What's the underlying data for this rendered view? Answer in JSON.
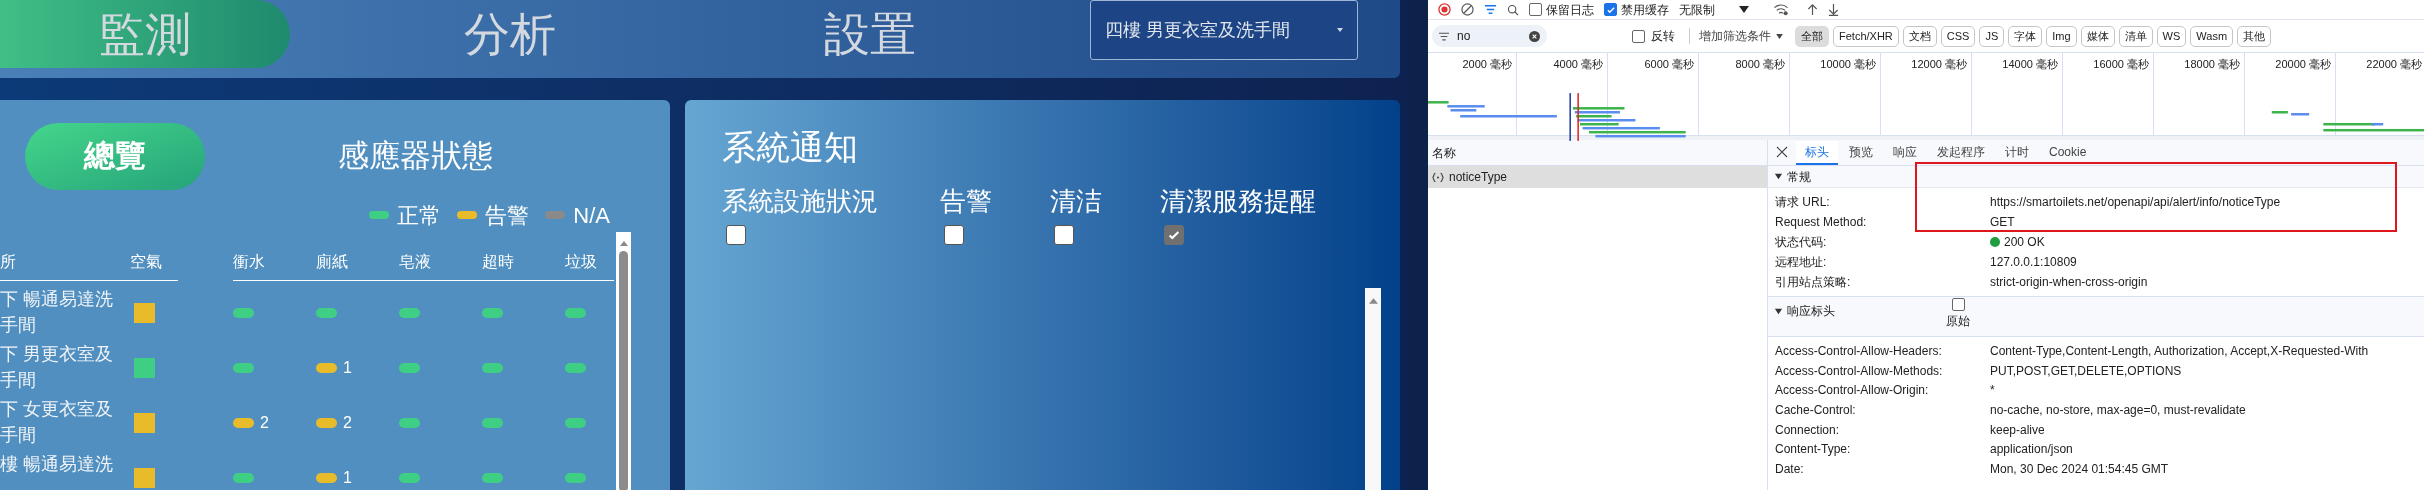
{
  "nav": {
    "tabs": [
      {
        "label": "監測",
        "selected": true
      },
      {
        "label": "分析",
        "selected": false
      },
      {
        "label": "設置",
        "selected": false
      }
    ],
    "location_select": {
      "value": "四樓 男更衣室及洗手間"
    }
  },
  "sensor_panel": {
    "overview_button": "總覽",
    "title": "感應器狀態",
    "legend": [
      {
        "label": "正常",
        "color": "#3ecf85"
      },
      {
        "label": "告警",
        "color": "#e8bb2b"
      },
      {
        "label": "N/A",
        "color": "#8a8a8a"
      }
    ],
    "columns": [
      "所",
      "空氣",
      "衝水",
      "廁紙",
      "皂液",
      "超時",
      "垃圾"
    ],
    "rows": [
      {
        "name": [
          "下 暢通易達洗",
          "手間"
        ],
        "air_alert": true,
        "sensors": [
          {
            "alert": false
          },
          {
            "alert": false
          },
          {
            "alert": false
          },
          {
            "alert": false
          },
          {
            "alert": false
          }
        ]
      },
      {
        "name": [
          "下 男更衣室及",
          "手間"
        ],
        "air_alert": false,
        "sensors": [
          {
            "alert": false
          },
          {
            "alert": true,
            "count": "1"
          },
          {
            "alert": false
          },
          {
            "alert": false
          },
          {
            "alert": false
          }
        ]
      },
      {
        "name": [
          "下 女更衣室及",
          "手間"
        ],
        "air_alert": true,
        "sensors": [
          {
            "alert": true,
            "count": "2"
          },
          {
            "alert": true,
            "count": "2"
          },
          {
            "alert": false
          },
          {
            "alert": false
          },
          {
            "alert": false
          }
        ]
      },
      {
        "name": [
          "樓 暢通易達洗"
        ],
        "air_alert": true,
        "sensors": [
          {
            "alert": false
          },
          {
            "alert": true,
            "count": "1"
          },
          {
            "alert": false
          },
          {
            "alert": false
          },
          {
            "alert": false
          }
        ]
      }
    ]
  },
  "notice_panel": {
    "title": "系統通知",
    "options": [
      {
        "label": "系統設施狀況",
        "checked": false
      },
      {
        "label": "告警",
        "checked": false
      },
      {
        "label": "清洁",
        "checked": false
      },
      {
        "label": "清潔服務提醒",
        "checked": true
      }
    ]
  },
  "devtools": {
    "toolbar": {
      "preserve_log": {
        "label": "保留日志",
        "checked": false
      },
      "disable_cache": {
        "label": "禁用缓存",
        "checked": true
      },
      "throttle": "无限制"
    },
    "filter": {
      "value": "no",
      "invert": {
        "label": "反转",
        "checked": false
      },
      "more_filters": "增加筛选条件",
      "types": [
        {
          "label": "全部",
          "selected": true
        },
        {
          "label": "Fetch/XHR",
          "selected": false
        },
        {
          "label": "文档",
          "selected": false
        },
        {
          "label": "CSS",
          "selected": false
        },
        {
          "label": "JS",
          "selected": false
        },
        {
          "label": "字体",
          "selected": false
        },
        {
          "label": "Img",
          "selected": false
        },
        {
          "label": "媒体",
          "selected": false
        },
        {
          "label": "清单",
          "selected": false
        },
        {
          "label": "WS",
          "selected": false
        },
        {
          "label": "Wasm",
          "selected": false
        },
        {
          "label": "其他",
          "selected": false
        }
      ]
    },
    "timeline_ticks": [
      "2000 毫秒",
      "4000 毫秒",
      "6000 毫秒",
      "8000 毫秒",
      "10000 毫秒",
      "12000 毫秒",
      "14000 毫秒",
      "16000 毫秒",
      "18000 毫秒",
      "20000 毫秒",
      "22000 毫秒"
    ],
    "requests": {
      "header": "名称",
      "items": [
        {
          "name": "noticeType",
          "selected": true
        }
      ]
    },
    "details": {
      "tabs": [
        {
          "label": "标头",
          "selected": true
        },
        {
          "label": "预览",
          "selected": false
        },
        {
          "label": "响应",
          "selected": false
        },
        {
          "label": "发起程序",
          "selected": false
        },
        {
          "label": "计时",
          "selected": false
        },
        {
          "label": "Cookie",
          "selected": false
        }
      ],
      "general": {
        "title": "常规",
        "expanded": true,
        "rows": [
          {
            "label": "请求 URL:",
            "value": "https://smartoilets.net/openapi/api/alert/info/noticeType"
          },
          {
            "label": "Request Method:",
            "value": "GET"
          },
          {
            "label": "状态代码:",
            "value": "200 OK",
            "kind": "status"
          },
          {
            "label": "远程地址:",
            "value": "127.0.0.1:10809"
          },
          {
            "label": "引用站点策略:",
            "value": "strict-origin-when-cross-origin"
          }
        ]
      },
      "response_headers": {
        "title": "响应标头",
        "expanded": true,
        "raw": {
          "label": "原始",
          "checked": false
        },
        "rows": [
          {
            "label": "Access-Control-Allow-Headers:",
            "value": "Content-Type,Content-Length, Authorization, Accept,X-Requested-With"
          },
          {
            "label": "Access-Control-Allow-Methods:",
            "value": "PUT,POST,GET,DELETE,OPTIONS"
          },
          {
            "label": "Access-Control-Allow-Origin:",
            "value": "*"
          },
          {
            "label": "Cache-Control:",
            "value": "no-cache, no-store, max-age=0, must-revalidate"
          },
          {
            "label": "Connection:",
            "value": "keep-alive"
          },
          {
            "label": "Content-Type:",
            "value": "application/json"
          },
          {
            "label": "Date:",
            "value": "Mon, 30 Dec 2024 01:54:45 GMT"
          }
        ]
      }
    }
  }
}
